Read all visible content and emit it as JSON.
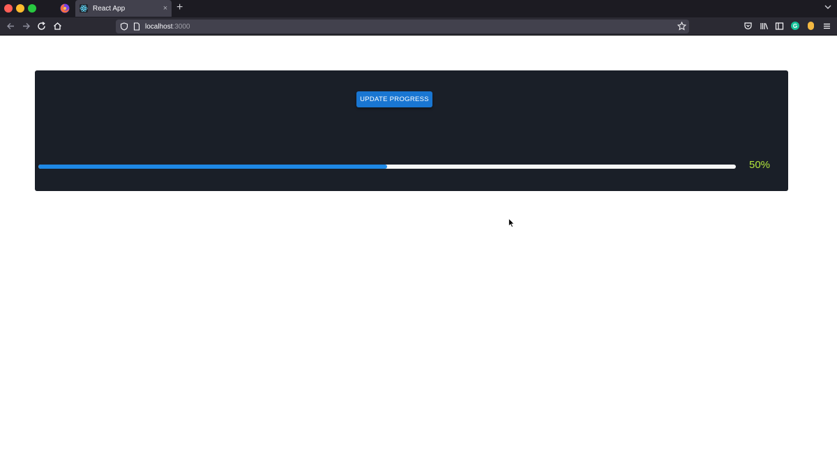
{
  "browser": {
    "tab_title": "React App",
    "new_tab": "+",
    "tab_close": "×",
    "url_host": "localhost",
    "url_port": ":3000"
  },
  "app": {
    "update_button_label": "UPDATE PROGRESS",
    "progress_label": "50%",
    "progress_fraction": 0.5
  },
  "colors": {
    "panel_bg": "#1a1f28",
    "button": "#1976d2",
    "progress_fill": "#1e88e5",
    "progress_track": "#f5f5f5",
    "progress_text": "#b3e63b"
  }
}
